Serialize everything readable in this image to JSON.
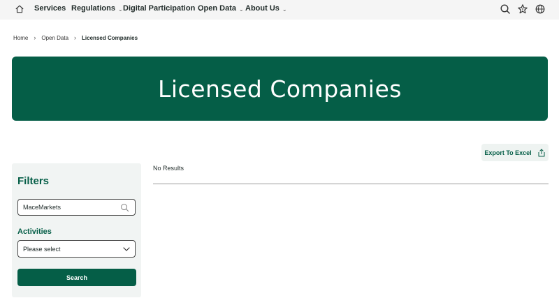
{
  "nav": {
    "items": [
      {
        "label": "Services",
        "has_dropdown": false
      },
      {
        "label": "Regulations",
        "has_dropdown": true
      },
      {
        "label": "Digital Participation",
        "has_dropdown": true
      },
      {
        "label": "Open Data",
        "has_dropdown": true
      },
      {
        "label": "About Us",
        "has_dropdown": true
      }
    ],
    "icons": [
      "home-icon",
      "search-icon",
      "star-icon",
      "globe-icon"
    ]
  },
  "breadcrumb": {
    "items": [
      "Home",
      "Open Data",
      "Licensed Companies"
    ]
  },
  "hero": {
    "title": "Licensed Companies"
  },
  "toolbar": {
    "export_label": "Export To Excel"
  },
  "filters": {
    "title": "Filters",
    "search_value": "MaceMarkets",
    "activities_label": "Activities",
    "activities_selected": "Please select",
    "search_button_label": "Search"
  },
  "results": {
    "empty_text": "No Results"
  },
  "colors": {
    "brand": "#055e47",
    "nav_bg": "#f5f5f5",
    "filter_bg": "#f1f4f3",
    "export_bg": "#eef3f1"
  }
}
